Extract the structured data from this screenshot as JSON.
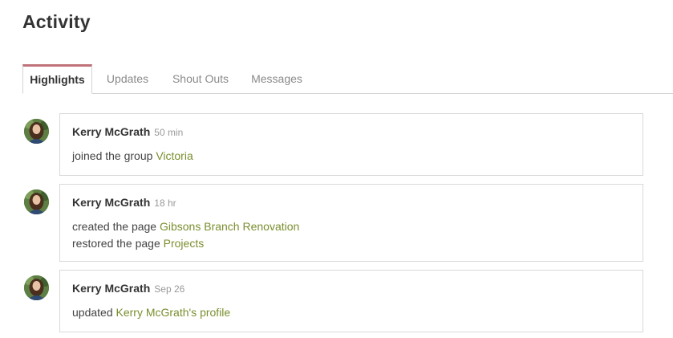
{
  "page": {
    "title": "Activity"
  },
  "tabs": [
    {
      "label": "Highlights",
      "active": true
    },
    {
      "label": "Updates",
      "active": false
    },
    {
      "label": "Shout Outs",
      "active": false
    },
    {
      "label": "Messages",
      "active": false
    }
  ],
  "colors": {
    "active_tab_accent": "#c0727a",
    "link": "#7a8e2e",
    "timestamp": "#999999",
    "card_border": "#d9d9d9"
  },
  "feed": [
    {
      "author": "Kerry McGrath",
      "time": "50 min",
      "avatar_icon": "user-avatar",
      "lines": [
        {
          "text": "joined the group ",
          "link": "Victoria"
        }
      ]
    },
    {
      "author": "Kerry McGrath",
      "time": "18 hr",
      "avatar_icon": "user-avatar",
      "lines": [
        {
          "text": "created the page ",
          "link": "Gibsons Branch Renovation"
        },
        {
          "text": "restored the page ",
          "link": "Projects"
        }
      ]
    },
    {
      "author": "Kerry McGrath",
      "time": "Sep 26",
      "avatar_icon": "user-avatar",
      "lines": [
        {
          "text": "updated ",
          "link": "Kerry McGrath's profile"
        }
      ]
    }
  ]
}
